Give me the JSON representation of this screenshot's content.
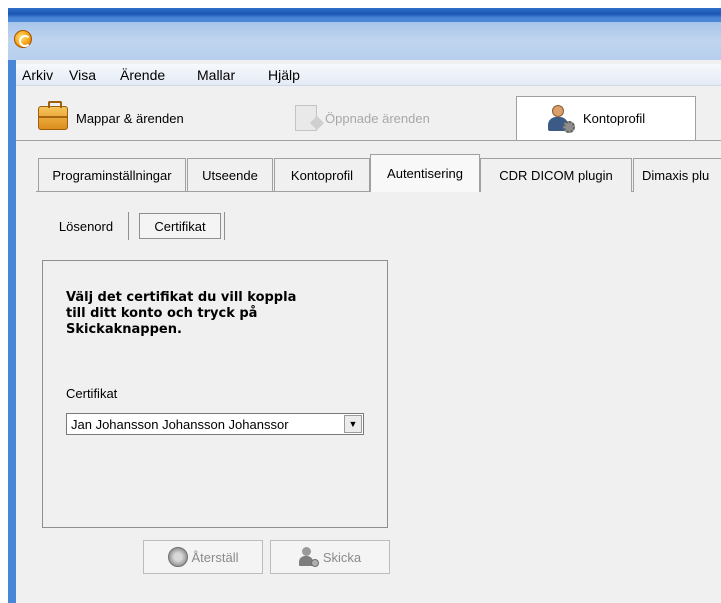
{
  "window": {
    "icon": "app-logo-icon"
  },
  "menu": {
    "items": [
      "Arkiv",
      "Visa",
      "Ärende",
      "Mallar",
      "Hjälp"
    ]
  },
  "nav": {
    "folders": {
      "label": "Mappar & ärenden",
      "icon": "briefcase-icon"
    },
    "opened": {
      "label": "Öppnade ärenden",
      "icon": "document-icon"
    },
    "account": {
      "label": "Kontoprofil",
      "icon": "user-settings-icon"
    }
  },
  "tabs": [
    "Programinställningar",
    "Utseende",
    "Kontoprofil",
    "Autentisering",
    "CDR DICOM plugin",
    "Dimaxis plu"
  ],
  "active_tab": "Autentisering",
  "subtabs": [
    "Lösenord",
    "Certifikat"
  ],
  "active_subtab": "Certifikat",
  "panel": {
    "instructions": "Välj det certifikat du vill koppla\ntill ditt konto och tryck på\nSkickaknappen.",
    "certificate_label": "Certifikat",
    "certificate_value": "Jan Johansson Johansson Johanssor"
  },
  "buttons": {
    "reset": "Återställ",
    "send": "Skicka"
  }
}
